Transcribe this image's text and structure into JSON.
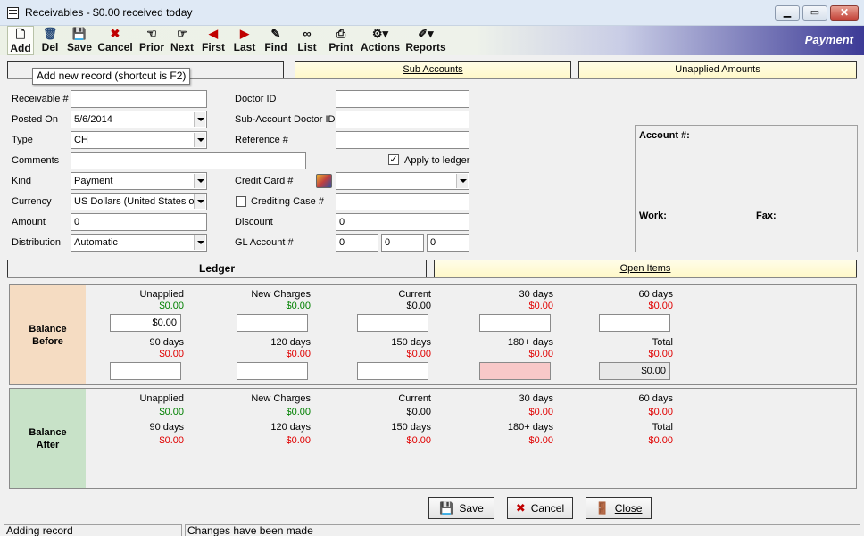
{
  "window": {
    "title": "Receivables  - $0.00 received today"
  },
  "toolbar": {
    "buttons": [
      {
        "label": "Add",
        "icon": "add-icon"
      },
      {
        "label": "Del",
        "icon": "trash-icon"
      },
      {
        "label": "Save",
        "icon": "floppy-icon"
      },
      {
        "label": "Cancel",
        "icon": "x-icon"
      },
      {
        "label": "Prior",
        "icon": "hand-left-icon"
      },
      {
        "label": "Next",
        "icon": "hand-right-icon"
      },
      {
        "label": "First",
        "icon": "first-icon"
      },
      {
        "label": "Last",
        "icon": "last-icon"
      },
      {
        "label": "Find",
        "icon": "find-icon"
      },
      {
        "label": "List",
        "icon": "list-icon"
      },
      {
        "label": "Print",
        "icon": "printer-icon"
      },
      {
        "label": "Actions",
        "icon": "actions-icon"
      },
      {
        "label": "Reports",
        "icon": "reports-icon"
      }
    ],
    "mode_label": "Payment"
  },
  "tooltip": "Add new record (shortcut is F2)",
  "tabs_top": {
    "sub_accounts": "Sub Accounts",
    "unapplied": "Unapplied Amounts"
  },
  "form": {
    "receivable_label": "Receivable #",
    "receivable_value": "",
    "posted_label": "Posted On",
    "posted_value": "5/6/2014",
    "type_label": "Type",
    "type_value": "CH",
    "comments_label": "Comments",
    "comments_value": "",
    "kind_label": "Kind",
    "kind_value": "Payment",
    "currency_label": "Currency",
    "currency_value": "US Dollars  (United States o",
    "amount_label": "Amount",
    "amount_value": "0",
    "distribution_label": "Distribution",
    "distribution_value": "Automatic",
    "doctor_label": "Doctor ID",
    "doctor_value": "",
    "subdoctor_label": "Sub-Account Doctor ID",
    "subdoctor_value": "",
    "reference_label": "Reference #",
    "reference_value": "",
    "apply_label": "Apply to ledger",
    "apply_checked": "✓",
    "creditcard_label": "Credit Card #",
    "creditcard_value": "",
    "crediting_label": "Crediting Case #",
    "crediting_value": "",
    "discount_label": "Discount",
    "discount_value": "0",
    "gl_label": "GL Account #",
    "gl_values": [
      "0",
      "0",
      "0"
    ]
  },
  "account_panel": {
    "account_label": "Account #:",
    "work_label": "Work:",
    "fax_label": "Fax:"
  },
  "tabs_mid": {
    "ledger": "Ledger",
    "open_items": "Open Items"
  },
  "balance_before": {
    "label": "Balance Before",
    "row1": [
      {
        "h": "Unapplied",
        "v": "$0.00",
        "c": "green",
        "box": "$0.00"
      },
      {
        "h": "New Charges",
        "v": "$0.00",
        "c": "green",
        "box": ""
      },
      {
        "h": "Current",
        "v": "$0.00",
        "c": "black",
        "box": ""
      },
      {
        "h": "30 days",
        "v": "$0.00",
        "c": "red",
        "box": ""
      },
      {
        "h": "60 days",
        "v": "$0.00",
        "c": "red",
        "box": ""
      }
    ],
    "row2": [
      {
        "h": "90 days",
        "v": "$0.00",
        "c": "red",
        "box": ""
      },
      {
        "h": "120 days",
        "v": "$0.00",
        "c": "red",
        "box": ""
      },
      {
        "h": "150 days",
        "v": "$0.00",
        "c": "red",
        "box": ""
      },
      {
        "h": "180+ days",
        "v": "$0.00",
        "c": "red",
        "box": ""
      },
      {
        "h": "Total",
        "v": "$0.00",
        "c": "red",
        "box": "$0.00"
      }
    ]
  },
  "balance_after": {
    "label": "Balance After",
    "row1": [
      {
        "h": "Unapplied",
        "v": "$0.00",
        "c": "green"
      },
      {
        "h": "New Charges",
        "v": "$0.00",
        "c": "green"
      },
      {
        "h": "Current",
        "v": "$0.00",
        "c": "black"
      },
      {
        "h": "30 days",
        "v": "$0.00",
        "c": "red"
      },
      {
        "h": "60 days",
        "v": "$0.00",
        "c": "red"
      }
    ],
    "row2": [
      {
        "h": "90 days",
        "v": "$0.00",
        "c": "red"
      },
      {
        "h": "120 days",
        "v": "$0.00",
        "c": "red"
      },
      {
        "h": "150 days",
        "v": "$0.00",
        "c": "red"
      },
      {
        "h": "180+ days",
        "v": "$0.00",
        "c": "red"
      },
      {
        "h": "Total",
        "v": "$0.00",
        "c": "red"
      }
    ]
  },
  "buttons": {
    "save": "Save",
    "cancel": "Cancel",
    "close": "Close"
  },
  "status": {
    "left": "Adding record",
    "right": "Changes have been made"
  },
  "colors": {
    "before_band": "#f5dcc2",
    "after_band": "#c8e2c8",
    "aged_highlight": "#f8c8c8"
  }
}
